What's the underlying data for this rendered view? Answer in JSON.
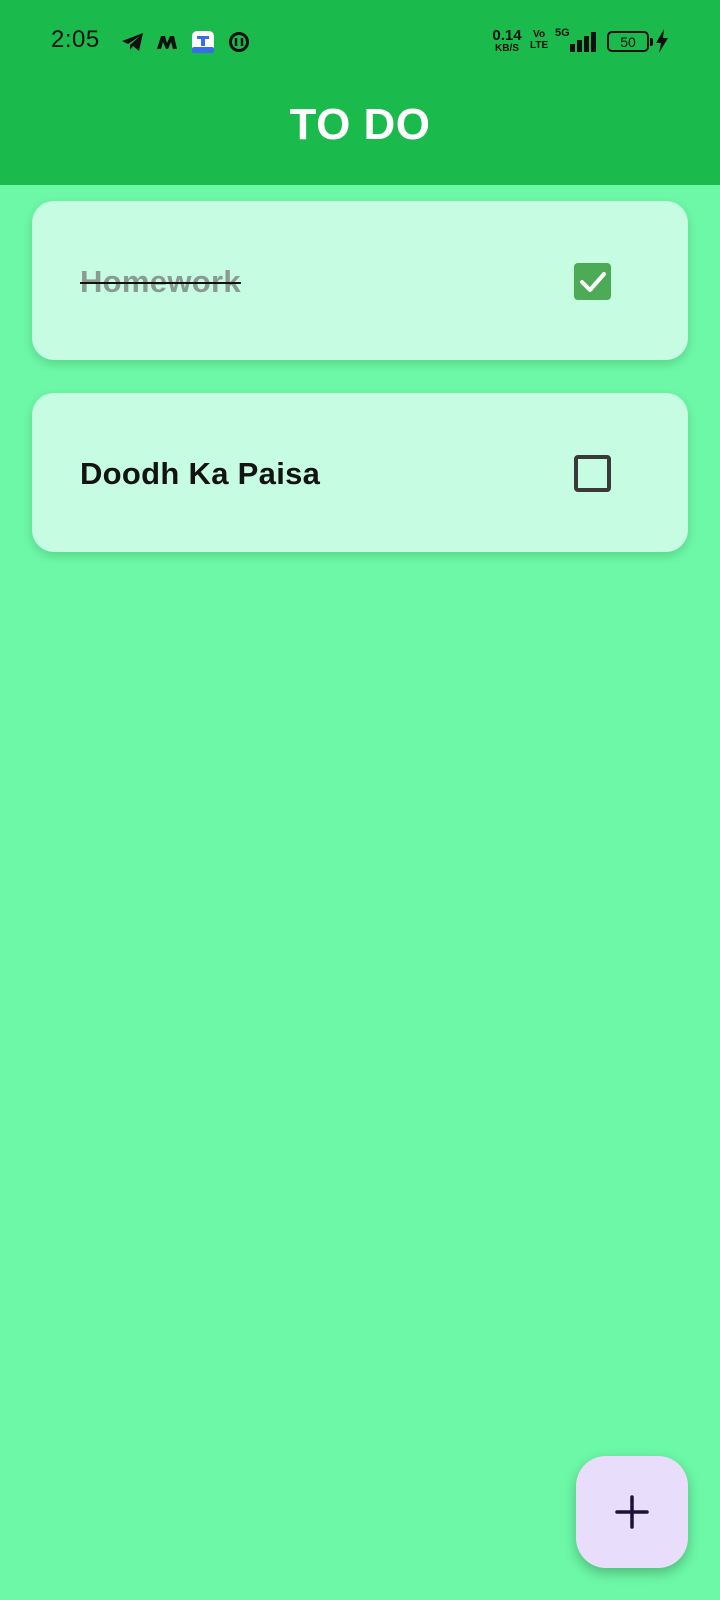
{
  "status_bar": {
    "time": "2:05",
    "net_speed_value": "0.14",
    "net_speed_unit": "KB/S",
    "volte_top": "Vo",
    "volte_bottom": "LTE",
    "network_type": "5G",
    "battery_level": "50",
    "notification_icons": [
      "telegram-icon",
      "m-app-icon",
      "app-store-icon",
      "threads-icon"
    ],
    "charging": true
  },
  "app_bar": {
    "title": "TO DO",
    "color": "#1abb4c"
  },
  "tasks": [
    {
      "label": "Homework",
      "completed": true
    },
    {
      "label": "Doodh Ka Paisa",
      "completed": false
    }
  ],
  "fab": {
    "icon": "plus-icon"
  },
  "colors": {
    "background": "#6cf8a6",
    "card": "#c6fde2",
    "checkbox_checked": "#4daa57",
    "fab": "#e8defb"
  }
}
